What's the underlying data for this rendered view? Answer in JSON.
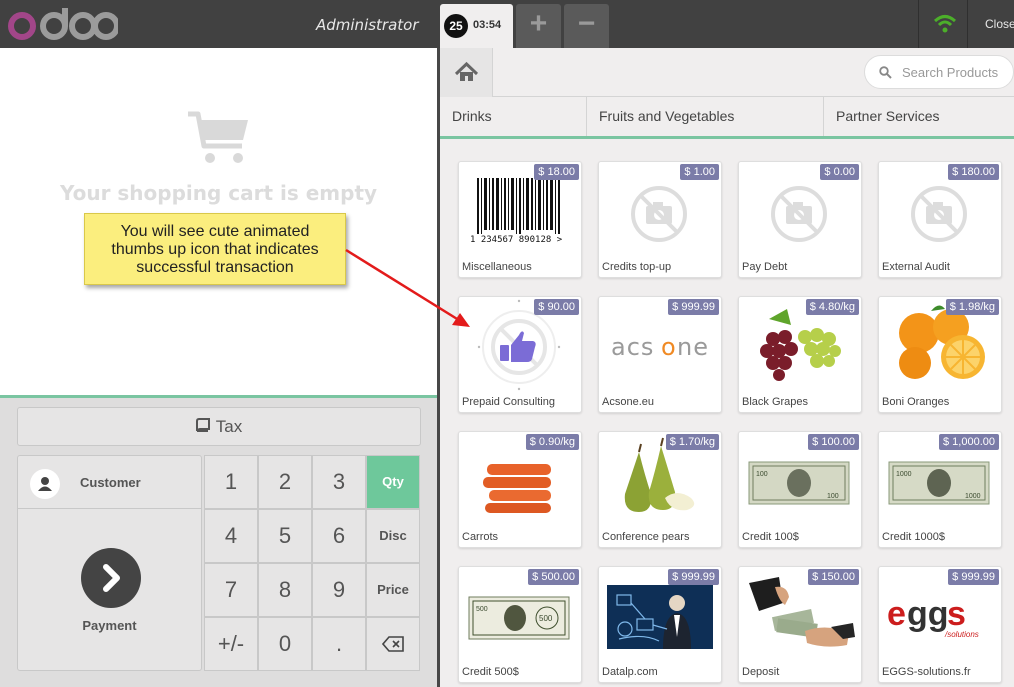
{
  "header": {
    "admin_label": "Administrator",
    "order_number": "25",
    "order_time": "03:54",
    "add_order_glyph": "+",
    "remove_order_glyph": "−",
    "close_label": "Close"
  },
  "cart": {
    "empty_text": "Your shopping cart is empty"
  },
  "tax_label": "Tax",
  "actions": {
    "customer_label": "Customer",
    "payment_label": "Payment"
  },
  "numpad": {
    "keys": [
      "1",
      "2",
      "3",
      "4",
      "5",
      "6",
      "7",
      "8",
      "9",
      "+/-",
      "0",
      "."
    ],
    "modes": [
      "Qty",
      "Disc",
      "Price"
    ],
    "active_mode": "Qty"
  },
  "search": {
    "placeholder": "Search Products"
  },
  "categories": [
    "Drinks",
    "Fruits and Vegetables",
    "Partner Services"
  ],
  "products": [
    {
      "name": "Miscellaneous",
      "price": "$ 18.00",
      "image": "barcode"
    },
    {
      "name": "Credits top-up",
      "price": "$ 1.00",
      "image": "no-photo"
    },
    {
      "name": "Pay Debt",
      "price": "$ 0.00",
      "image": "no-photo"
    },
    {
      "name": "External Audit",
      "price": "$ 180.00",
      "image": "no-photo"
    },
    {
      "name": "Prepaid Consulting",
      "price": "$ 90.00",
      "image": "thumbs-up"
    },
    {
      "name": "Acsone.eu",
      "price": "$ 999.99",
      "image": "acsone-logo"
    },
    {
      "name": "Black Grapes",
      "price": "$ 4.80/kg",
      "image": "grapes"
    },
    {
      "name": "Boni Oranges",
      "price": "$ 1.98/kg",
      "image": "oranges"
    },
    {
      "name": "Carrots",
      "price": "$ 0.90/kg",
      "image": "carrots"
    },
    {
      "name": "Conference pears",
      "price": "$ 1.70/kg",
      "image": "pears"
    },
    {
      "name": "Credit 100$",
      "price": "$ 100.00",
      "image": "banknote"
    },
    {
      "name": "Credit 1000$",
      "price": "$ 1,000.00",
      "image": "banknote"
    },
    {
      "name": "Credit 500$",
      "price": "$ 500.00",
      "image": "banknote"
    },
    {
      "name": "Datalp.com",
      "price": "$ 999.99",
      "image": "datalp"
    },
    {
      "name": "Deposit",
      "price": "$ 150.00",
      "image": "cash-hands"
    },
    {
      "name": "EGGS-solutions.fr",
      "price": "$ 999.99",
      "image": "eggs-logo"
    }
  ],
  "barcode_digits": "1 234567 890128 >",
  "banknote_marks": [
    "100",
    "1000",
    "500"
  ],
  "callout": {
    "lines": [
      "You will see cute animated",
      "thumbs up icon that indicates",
      "successful transaction"
    ]
  },
  "colors": {
    "header_bg": "#414141",
    "accent_green": "#6ec89b",
    "price_badge": "#7b7ca8",
    "callout_bg": "#fbee7e",
    "thumbs_up": "#7b6cd6",
    "wifi": "#4caf2a",
    "arrow": "#e31b1b"
  }
}
